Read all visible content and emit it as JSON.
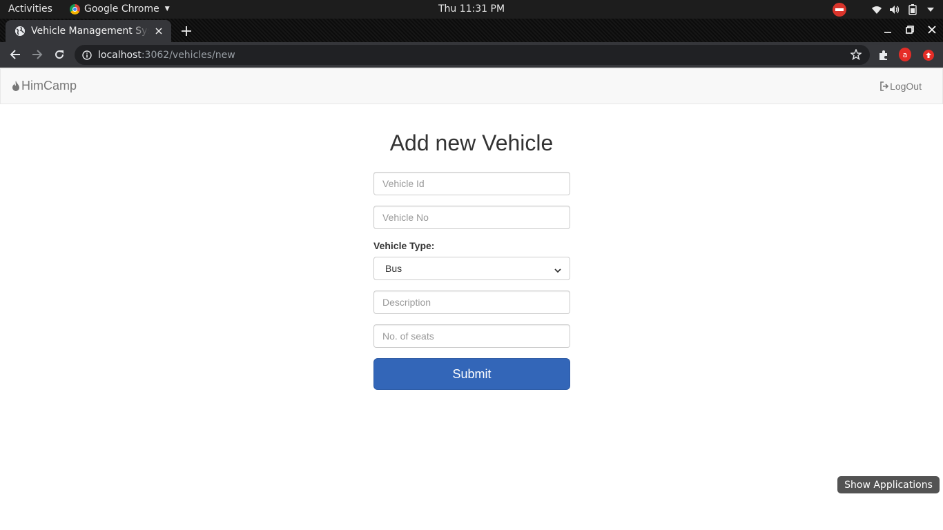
{
  "system_bar": {
    "activities": "Activities",
    "app_name": "Google Chrome",
    "clock": "Thu 11:31 PM"
  },
  "browser": {
    "tab_title": "Vehicle Management System",
    "url_host": "localhost",
    "url_path": ":3062/vehicles/new",
    "profile_initial": "a"
  },
  "app": {
    "brand": "HimCamp",
    "logout_label": "LogOut"
  },
  "form": {
    "heading": "Add new Vehicle",
    "vehicle_id_placeholder": "Vehicle Id",
    "vehicle_no_placeholder": "Vehicle No",
    "vehicle_type_label": "Vehicle Type:",
    "vehicle_type_value": "Bus",
    "description_placeholder": "Description",
    "seats_placeholder": "No. of seats",
    "submit_label": "Submit"
  },
  "overlay": {
    "show_applications": "Show Applications"
  },
  "colors": {
    "submit_bg": "#3366b8",
    "navbar_bg": "#f8f8f8",
    "chrome_toolbar": "#35363a"
  }
}
